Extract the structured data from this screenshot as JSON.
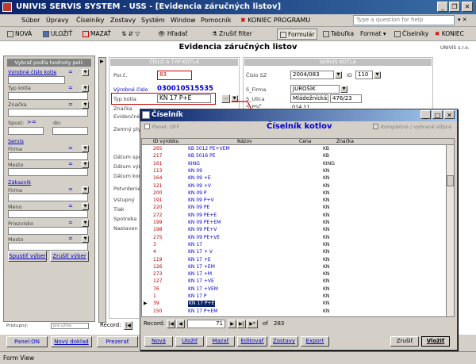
{
  "window": {
    "title": "UNIVIS SERVIS SYSTEM - USS - [Evidencia záručných listov]"
  },
  "menu": [
    "Súbor",
    "Úpravy",
    "Číselníky",
    "Zostavy",
    "Systém",
    "Window",
    "Pomocník",
    "KONIEC PROGRAMU"
  ],
  "help_placeholder": "Type a question for help",
  "toolbar": {
    "nova": "NOVÁ",
    "ulozit": "ULOŽIŤ",
    "mazat": "MAZAŤ",
    "hladat": "Hľadať",
    "zrusit_filter": "Zrušiť filter",
    "formular": "Formulár",
    "tabulka": "Tabuľka",
    "format": "Format",
    "ciselniky": "Číselníky",
    "koniec": "KONIEC"
  },
  "form": {
    "title": "Evidencia záručných listov",
    "brand": "UNIVIS s.r.o.",
    "section_cislo": "ČÍSLO A TYP KOTLA",
    "section_servis": "SERVIS KOTLA",
    "por_c_label": "Por.č.",
    "por_c_value": "83",
    "vyrobne_label": "Výrobné číslo",
    "vyrobne_value": "030010515535",
    "typ_label": "Typ kotla",
    "typ_value": "KN 17 P+E",
    "znacka_label": "Značka",
    "evid_label": "Evidenčné",
    "zemny_label": "Zemný ply",
    "cislo_sz_label": "Číslo SZ",
    "cislo_sz_value": "2004/083",
    "id_label": "ID",
    "id_value": "110",
    "s_firma_label": "S_Firma",
    "s_firma_value": "JUROŠÍK",
    "s_ulica_label": "S_Ulica",
    "s_ulica_value": "Mládežnícká",
    "s_ulica_num": "476/23",
    "s_psc_label": "S_PSČ",
    "s_psc_value": "014 11",
    "left_labels": [
      "Dátum spo",
      "Dátum výr",
      "Dátum kon",
      "Potvrdenie",
      "Vstupný",
      "Tlak",
      "Spotreba",
      "Nastaven"
    ],
    "record_label": "Record:"
  },
  "sidebar": {
    "header": "Vybrať podľa hodnoty polí:",
    "vyrobne": "Výrobné číslo kotle",
    "typ": "Typ kotla",
    "znacka": "Značka",
    "spust": "Spust:",
    "spust_op": ">=",
    "do": "do:",
    "servis": "Servis",
    "firma": "Firma",
    "mesto": "Mesto",
    "zakaznik": "Zákazník",
    "firma2": "Firma",
    "meno": "Meno",
    "priezvisko": "Priezvisko",
    "mesto2": "Mesto",
    "eq": "=",
    "spustit": "Spustiť výber",
    "zrusit": "Zrušiť výber",
    "pristupny": "Prístupný:",
    "pristupny_val": "pre užíve"
  },
  "bottom": {
    "panel_on": "Panel:ON",
    "novy_doklad": "Nový doklad",
    "prezerat": "Prezerať"
  },
  "dialog": {
    "title": "Číselník",
    "panel_off": "Panel: OFF",
    "heading": "Číselník kotlov",
    "kompletne": "Kompletné / vybrané stĺpce",
    "columns": [
      "ID vyrobku",
      "Názov",
      "Cena",
      "Značka"
    ],
    "rows": [
      [
        "265",
        "KB 5012 PE+VEM",
        "",
        "KB"
      ],
      [
        "217",
        "KB 5016 PE",
        "",
        "KB"
      ],
      [
        "161",
        "KING",
        "",
        "KING"
      ],
      [
        "113",
        "KN 09",
        "",
        "KN"
      ],
      [
        "164",
        "KN 09 +E",
        "",
        "KN"
      ],
      [
        "121",
        "KN 09 +V",
        "",
        "KN"
      ],
      [
        "200",
        "KN 09 P",
        "",
        "KN"
      ],
      [
        "191",
        "KN 09 P+V",
        "",
        "KN"
      ],
      [
        "220",
        "KN 09 PE",
        "",
        "KN"
      ],
      [
        "272",
        "KN 09 PE+E",
        "",
        "KN"
      ],
      [
        "199",
        "KN 09 PE+EM",
        "",
        "KN"
      ],
      [
        "198",
        "KN 09 PE+V",
        "",
        "KN"
      ],
      [
        "275",
        "KN 09 PE+VE",
        "",
        "KN"
      ],
      [
        "3",
        "KN 17",
        "",
        "KN"
      ],
      [
        "4",
        "KN 17 + V",
        "",
        "KN"
      ],
      [
        "119",
        "KN 17 +E",
        "",
        "KN"
      ],
      [
        "126",
        "KN 17 +EM",
        "",
        "KN"
      ],
      [
        "273",
        "KN 17 +M",
        "",
        "KN"
      ],
      [
        "127",
        "KN 17 +VE",
        "",
        "KN"
      ],
      [
        "76",
        "KN 17 +VEM",
        "",
        "KN"
      ],
      [
        "1",
        "KN 17 P",
        "",
        "KN"
      ],
      [
        "39",
        "KN 17 P+E",
        "",
        "KN"
      ],
      [
        "150",
        "KN 17 P+EM",
        "",
        "KN"
      ]
    ],
    "record_label": "Record:",
    "record_current": "71",
    "record_of": "of",
    "record_total": "283",
    "buttons": [
      "Nová",
      "Uložiť",
      "Mazať",
      "Editovať",
      "Zostavy",
      "Export"
    ],
    "zrusit": "Zrušiť",
    "vlozit": "Vložiť"
  },
  "status": "Form View"
}
